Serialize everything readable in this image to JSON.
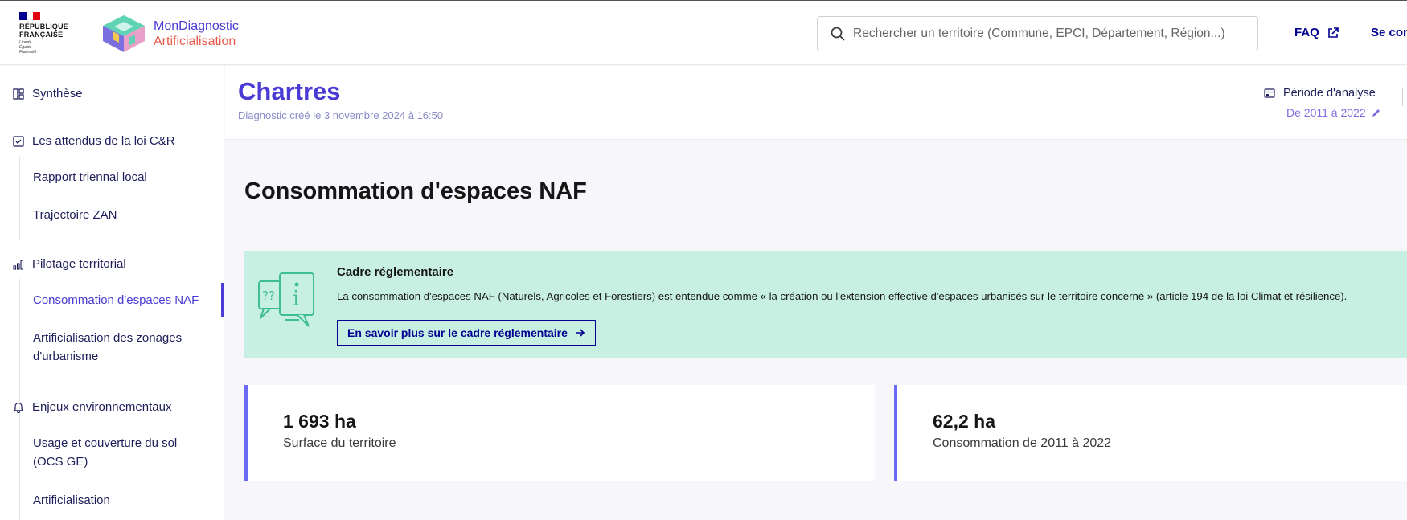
{
  "header": {
    "gov_line1": "RÉPUBLIQUE",
    "gov_line2": "FRANÇAISE",
    "gov_motto1": "Liberté",
    "gov_motto2": "Égalité",
    "gov_motto3": "Fraternité",
    "brand_line1": "MonDiagnostic",
    "brand_line2": "Artificialisation",
    "search_placeholder": "Rechercher un territoire (Commune, EPCI, Département, Région...)",
    "faq_label": "FAQ",
    "login_label": "Se connecter"
  },
  "sidebar": {
    "sections": [
      {
        "label": "Synthèse",
        "icon": "dashboard-icon"
      },
      {
        "label": "Les attendus de la loi C&R",
        "icon": "checkbox-icon"
      },
      {
        "label": "Pilotage territorial",
        "icon": "bar-chart-icon"
      },
      {
        "label": "Enjeux environnementaux",
        "icon": "bell-icon"
      }
    ],
    "items": [
      {
        "label": "Rapport triennal local"
      },
      {
        "label": "Trajectoire ZAN"
      },
      {
        "label": "Consommation d'espaces NAF",
        "active": true
      },
      {
        "label": "Artificialisation des zonages d'urbanisme"
      },
      {
        "label": "Usage et couverture du sol (OCS GE)"
      },
      {
        "label": "Artificialisation"
      }
    ]
  },
  "titlebar": {
    "city": "Chartres",
    "created": "Diagnostic créé le 3 novembre 2024 à 16:50",
    "periode_label": "Période d'analyse",
    "periode_value": "De 2011 à 2022"
  },
  "main": {
    "heading": "Consommation d'espaces NAF",
    "callout": {
      "title": "Cadre réglementaire",
      "text": "La consommation d'espaces NAF (Naturels, Agricoles et Forestiers) est entendue comme « la création ou l'extension effective d'espaces urbanisés sur le territoire concerné » (article 194 de la loi Climat et résilience).",
      "button_label": "En savoir plus sur le cadre réglementaire",
      "illustration_text1": "??",
      "illustration_text2": "i"
    },
    "cards": [
      {
        "value": "1 693 ha",
        "label": "Surface du territoire"
      },
      {
        "value": "62,2 ha",
        "label": "Consommation de 2011 à 2022"
      }
    ]
  },
  "colors": {
    "accent": "#4a3bd4",
    "brand_red": "#e8594a",
    "callout_bg": "#c8f0e2",
    "card_border": "#6a6af4",
    "link_blue": "#000091"
  }
}
